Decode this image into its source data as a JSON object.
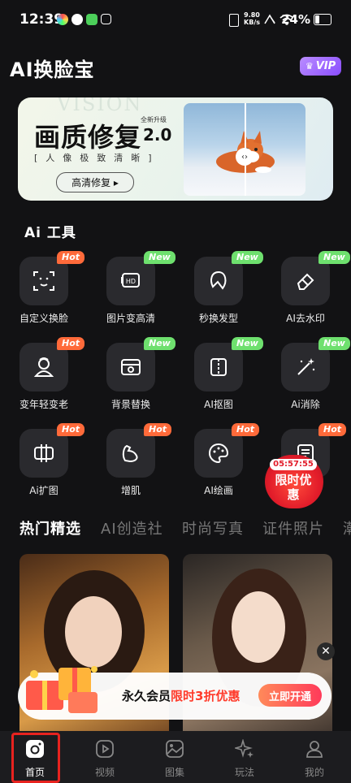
{
  "status_bar": {
    "time": "12:39",
    "net_speed": "9.80",
    "net_unit": "KB/s",
    "battery": "24%"
  },
  "header": {
    "title": "AI换脸宝",
    "vip_label": "VIP"
  },
  "banner": {
    "bg_text": "VISION",
    "title": "画质修复",
    "badge": "全新升级",
    "version": "2.0",
    "subtitle": "[人像极致清晰]",
    "button": "高清修复 ▸",
    "divider_knob": "‹›"
  },
  "tools": {
    "title": "Ai 工具",
    "items": [
      {
        "label": "自定义换脸",
        "tag": "Hot",
        "icon": "face-scan-icon"
      },
      {
        "label": "图片变高清",
        "tag": "New",
        "icon": "hd-image-icon"
      },
      {
        "label": "秒换发型",
        "tag": "New",
        "icon": "hairstyle-icon"
      },
      {
        "label": "AI去水印",
        "tag": "New",
        "icon": "eraser-icon"
      },
      {
        "label": "变年轻变老",
        "tag": "Hot",
        "icon": "age-face-icon"
      },
      {
        "label": "背景替换",
        "tag": "New",
        "icon": "background-icon"
      },
      {
        "label": "AI抠图",
        "tag": "New",
        "icon": "cutout-icon"
      },
      {
        "label": "Ai消除",
        "tag": "New",
        "icon": "magic-wand-icon"
      },
      {
        "label": "Ai扩图",
        "tag": "Hot",
        "icon": "expand-icon"
      },
      {
        "label": "增肌",
        "tag": "Hot",
        "icon": "muscle-icon"
      },
      {
        "label": "AI绘画",
        "tag": "Hot",
        "icon": "palette-icon"
      },
      {
        "label": "",
        "tag": "Hot",
        "icon": "document-icon"
      }
    ]
  },
  "promo": {
    "timer": "05:57:55",
    "text": "限时优惠"
  },
  "category_tabs": [
    "热门精选",
    "AI创造社",
    "时尚写真",
    "证件照片",
    "潮"
  ],
  "membership": {
    "text": "永久会员",
    "highlight": "限时3折优惠",
    "button": "立即开通",
    "close": "✕"
  },
  "nav": [
    {
      "label": "首页",
      "icon": "home-camera-icon"
    },
    {
      "label": "视频",
      "icon": "video-icon"
    },
    {
      "label": "图集",
      "icon": "gallery-icon"
    },
    {
      "label": "玩法",
      "icon": "sparkle-icon"
    },
    {
      "label": "我的",
      "icon": "profile-icon"
    }
  ],
  "colors": {
    "hot": "#ff6a3a",
    "new": "#6ee06e",
    "accent": "#ff3a2a",
    "vip": "#9a5cff"
  }
}
